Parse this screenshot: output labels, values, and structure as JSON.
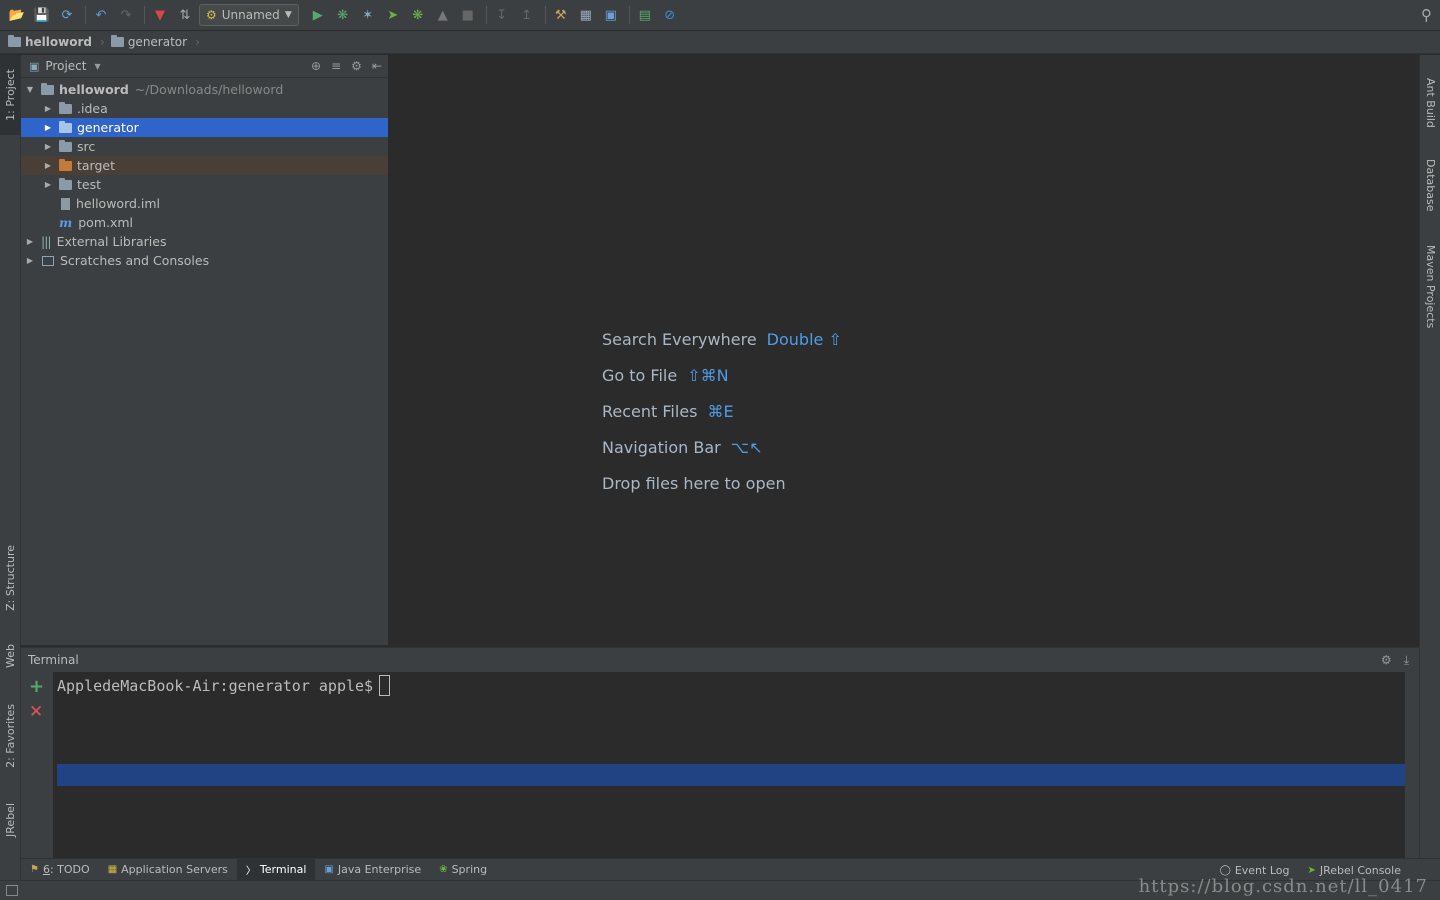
{
  "toolbar": {
    "run_config": "Unnamed",
    "icons": [
      "open-icon",
      "save-icon",
      "sync-icon",
      "back-icon",
      "forward-icon",
      "build-icon",
      "make-icon",
      "run-icon",
      "debug-icon",
      "coverage-icon",
      "jrebel-run-icon",
      "jrebel-debug-icon",
      "profile-icon",
      "stop-icon",
      "vcs-update-icon",
      "vcs-commit-icon",
      "settings-icon",
      "project-structure-icon",
      "sdk-icon",
      "event-icon",
      "disabled-icon",
      "search-everywhere-icon"
    ]
  },
  "navbar": {
    "crumbs": [
      "helloword",
      "generator"
    ]
  },
  "left_strip": {
    "project": "1: Project",
    "structure": "Z: Structure",
    "web": "Web",
    "favorites": "2: Favorites",
    "jrebel": "JRebel"
  },
  "right_strip": {
    "ant": "Ant Build",
    "database": "Database",
    "maven": "Maven Projects"
  },
  "project_panel": {
    "title": "Project",
    "root": {
      "name": "helloword",
      "path": "~/Downloads/helloword"
    },
    "children": [
      ".idea",
      "generator",
      "src",
      "target",
      "test"
    ],
    "files": [
      "helloword.iml",
      "pom.xml"
    ],
    "external": "External Libraries",
    "scratches": "Scratches and Consoles"
  },
  "editor": {
    "hints": [
      {
        "label": "Search Everywhere",
        "key": "Double ⇧"
      },
      {
        "label": "Go to File",
        "key": "⇧⌘N"
      },
      {
        "label": "Recent Files",
        "key": "⌘E"
      },
      {
        "label": "Navigation Bar",
        "key": "⌥↖"
      },
      {
        "label": "Drop files here to open",
        "key": ""
      }
    ]
  },
  "terminal": {
    "title": "Terminal",
    "prompt": "AppledeMacBook-Air:generator apple$"
  },
  "bottom_tabs": {
    "todo_num": "6",
    "todo": ": TODO",
    "app_servers": "Application Servers",
    "terminal": "Terminal",
    "java_ee": "Java Enterprise",
    "spring": "Spring",
    "event_log": "Event Log",
    "jrebel_console": "JRebel Console"
  },
  "watermark": "https://blog.csdn.net/ll_0417",
  "colors": {
    "selection": "#2f65ca",
    "terminal_selection": "#214283",
    "accent_key": "#4e9ce8",
    "excluded_folder": "#c27b3a"
  }
}
